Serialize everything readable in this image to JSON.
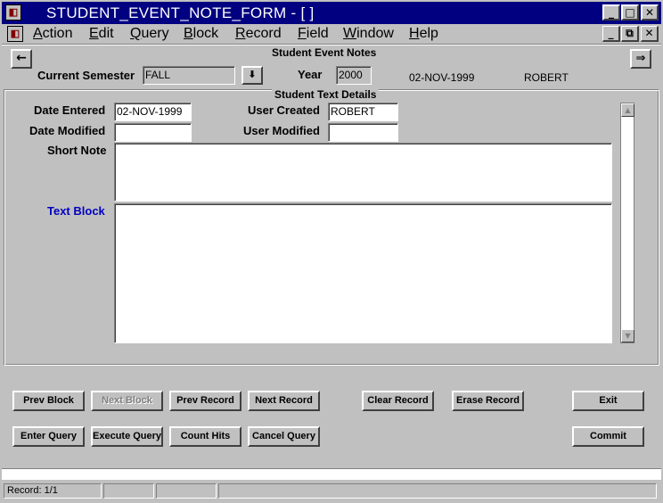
{
  "window": {
    "title": "STUDENT_EVENT_NOTE_FORM - [ ]",
    "minimize": "_",
    "maximize": "□",
    "close": "✕"
  },
  "menu": {
    "items": [
      "Action",
      "Edit",
      "Query",
      "Block",
      "Record",
      "Field",
      "Window",
      "Help"
    ],
    "underline": [
      "A",
      "E",
      "Q",
      "B",
      "R",
      "F",
      "W",
      "H"
    ],
    "mdi_minimize": "_",
    "mdi_restore": "⧉",
    "mdi_close": "✕"
  },
  "header": {
    "title": "Student Event Notes",
    "semester_label": "Current Semester",
    "semester_value": "FALL",
    "year_label": "Year",
    "year_value": "2000",
    "date": "02-NOV-1999",
    "user": "ROBERT",
    "lov_icon": "⬇",
    "back_icon": "←",
    "forward_icon": "⇒"
  },
  "details": {
    "frame_title": "Student Text Details",
    "date_entered_label": "Date Entered",
    "date_entered_value": "02-NOV-1999",
    "user_created_label": "User Created",
    "user_created_value": "ROBERT",
    "date_modified_label": "Date Modified",
    "date_modified_value": "",
    "user_modified_label": "User Modified",
    "user_modified_value": "",
    "short_note_label": "Short Note",
    "short_note_value": "",
    "text_block_label": "Text Block",
    "text_block_value": ""
  },
  "buttons": {
    "prev_block": "Prev Block",
    "next_block": "Next Block",
    "prev_record": "Prev Record",
    "next_record": "Next Record",
    "clear_record": "Clear Record",
    "erase_record": "Erase Record",
    "exit": "Exit",
    "enter_query": "Enter Query",
    "execute_query": "Execute Query",
    "count_hits": "Count Hits",
    "cancel_query": "Cancel Query",
    "commit": "Commit"
  },
  "status": {
    "record": "Record: 1/1"
  },
  "colors": {
    "titlebar": "#000080",
    "face": "#c0c0c0",
    "text_block_label": "#0000c0"
  }
}
